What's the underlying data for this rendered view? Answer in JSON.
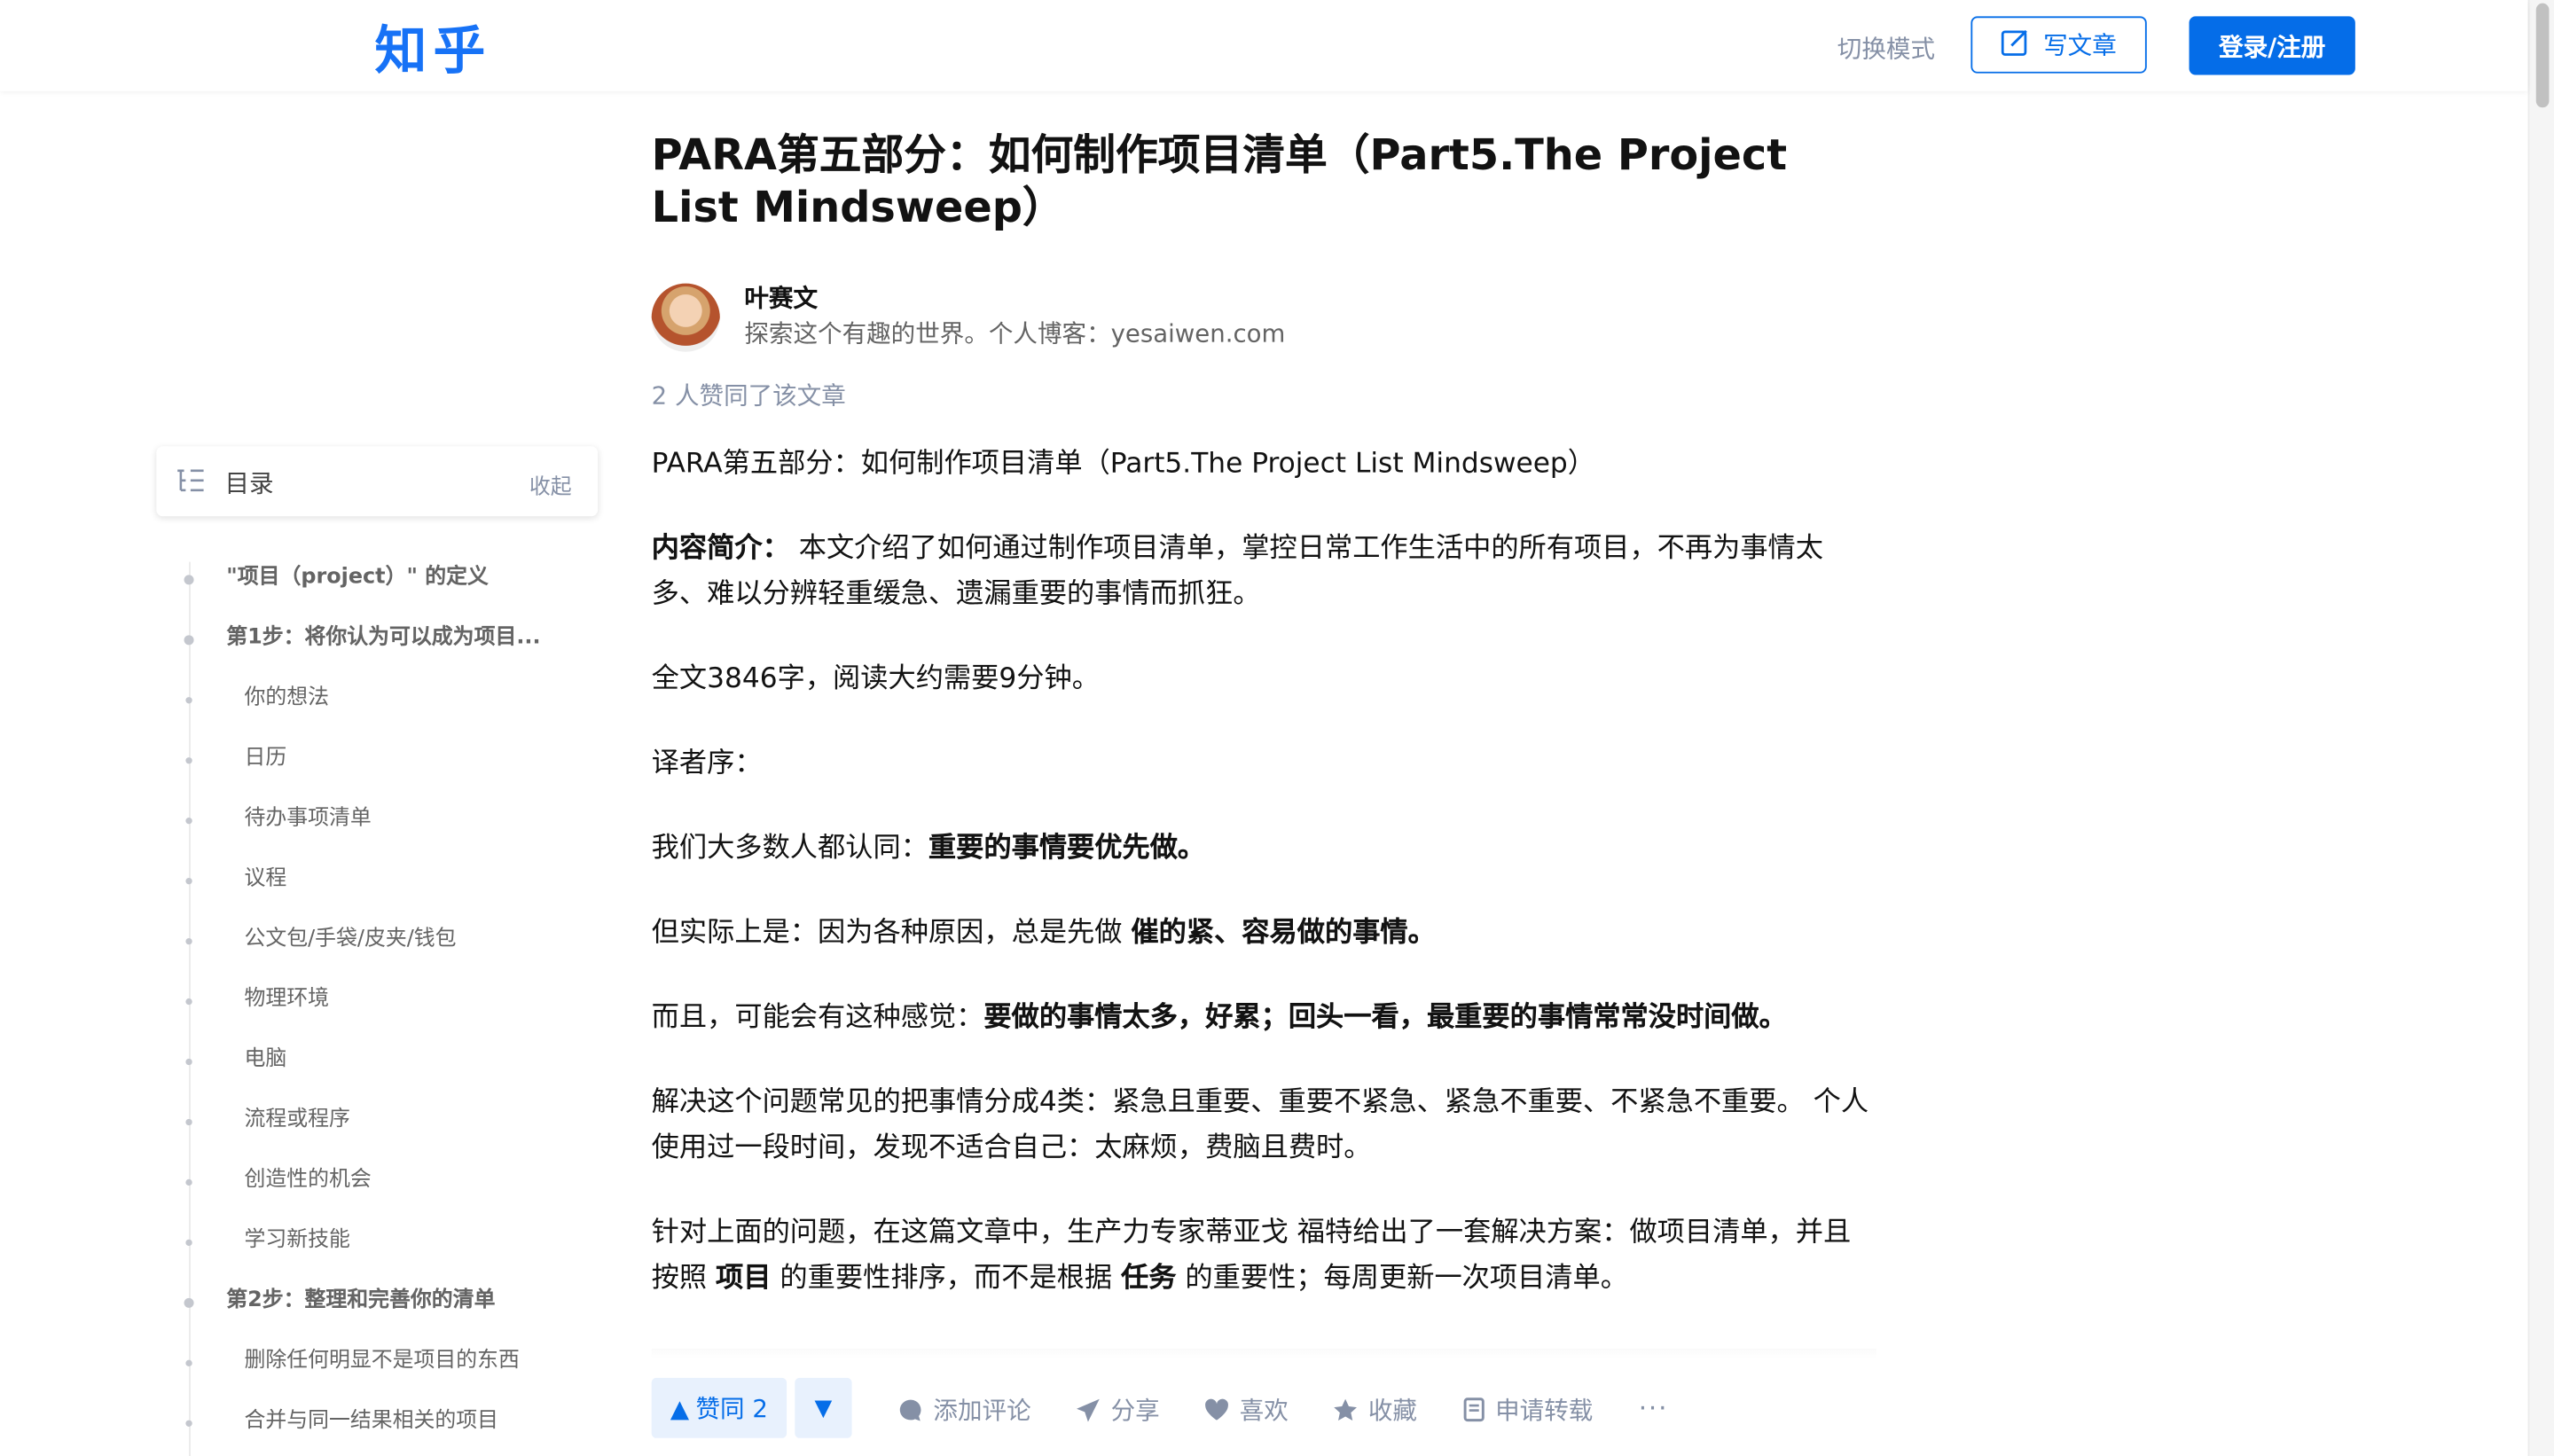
{
  "header": {
    "logo": "知乎",
    "switch_mode": "切换模式",
    "write_article": "写文章",
    "login": "登录/注册"
  },
  "toc": {
    "title": "目录",
    "collapse": "收起",
    "items": [
      {
        "label": "\"项目（project）\" 的定义",
        "level": 1
      },
      {
        "label": "第1步：将你认为可以成为项目...",
        "level": 1
      },
      {
        "label": "你的想法",
        "level": 2
      },
      {
        "label": "日历",
        "level": 2
      },
      {
        "label": "待办事项清单",
        "level": 2
      },
      {
        "label": "议程",
        "level": 2
      },
      {
        "label": "公文包/手袋/皮夹/钱包",
        "level": 2
      },
      {
        "label": "物理环境",
        "level": 2
      },
      {
        "label": "电脑",
        "level": 2
      },
      {
        "label": "流程或程序",
        "level": 2
      },
      {
        "label": "创造性的机会",
        "level": 2
      },
      {
        "label": "学习新技能",
        "level": 2
      },
      {
        "label": "第2步：整理和完善你的清单",
        "level": 1
      },
      {
        "label": "删除任何明显不是项目的东西",
        "level": 2
      },
      {
        "label": "合并与同一结果相关的项目",
        "level": 2
      }
    ]
  },
  "article": {
    "title": "PARA第五部分：如何制作项目清单（Part5.The Project List Mindsweep）",
    "author_name": "叶赛文",
    "author_desc": "探索这个有趣的世界。个人博客：yesaiwen.com",
    "upvote_text": "2 人赞同了该文章",
    "p1": "PARA第五部分：如何制作项目清单（Part5.The Project List Mindsweep）",
    "p2_label": "内容简介：",
    "p2_text": " 本文介绍了如何通过制作项目清单，掌控日常工作生活中的所有项目，不再为事情太多、难以分辨轻重缓急、遗漏重要的事情而抓狂。",
    "p3": "全文3846字，阅读大约需要9分钟。",
    "p4": "译者序：",
    "p5_a": "我们大多数人都认同：",
    "p5_b": "重要的事情要优先做。",
    "p6_a": "但实际上是：因为各种原因，总是先做 ",
    "p6_b": "催的紧、容易做的事情。",
    "p7_a": "而且，可能会有这种感觉：",
    "p7_b": "要做的事情太多，好累；回头一看，最重要的事情常常没时间做。",
    "p8": "解决这个问题常见的把事情分成4类：紧急且重要、重要不紧急、紧急不重要、不紧急不重要。 个人使用过一段时间，发现不适合自己：太麻烦，费脑且费时。",
    "p9_a": "针对上面的问题，在这篇文章中，生产力专家蒂亚戈 福特给出了一套解决方案：做项目清单，并且按照 ",
    "p9_b": "项目",
    "p9_c": " 的重要性排序，而不是根据 ",
    "p9_d": "任务",
    "p9_e": " 的重要性；每周更新一次项目清单。"
  },
  "actions": {
    "upvote": "赞同 2",
    "comment": "添加评论",
    "share": "分享",
    "like": "喜欢",
    "collect": "收藏",
    "repost": "申请转载",
    "more": "···"
  },
  "colors": {
    "brand": "#056de8",
    "logo": "#1772f6",
    "secondary_text": "#8590a6"
  }
}
